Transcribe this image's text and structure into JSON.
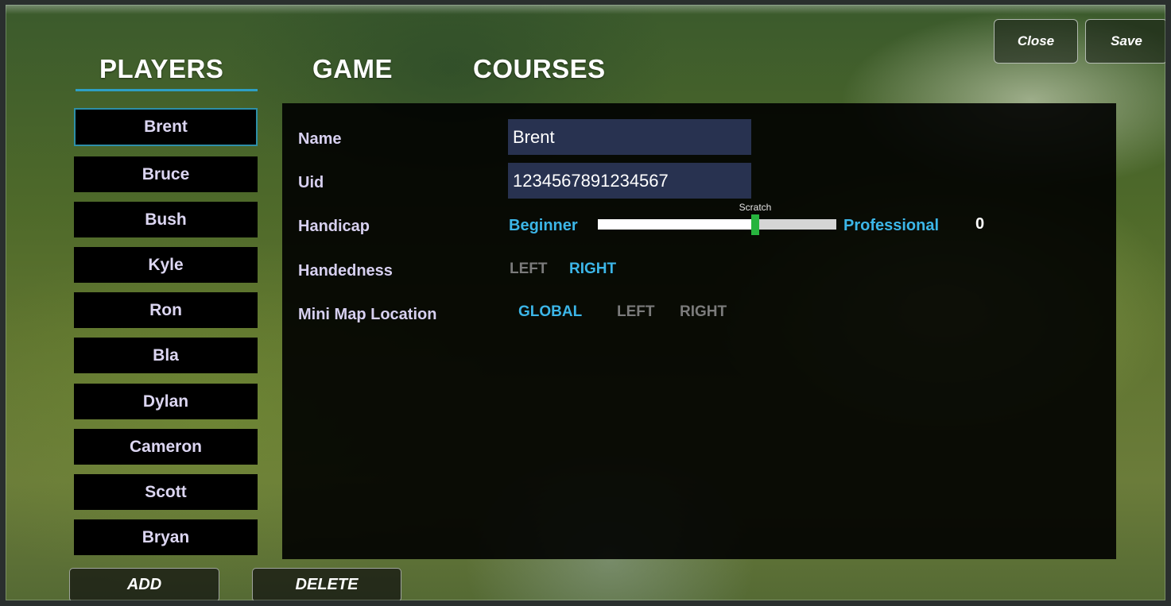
{
  "tabs": {
    "players": "PLAYERS",
    "game": "GAME",
    "courses": "COURSES"
  },
  "toolbar": {
    "close_label": "Close",
    "save_label": "Save"
  },
  "players": [
    "Brent",
    "Bruce",
    "Bush",
    "Kyle",
    "Ron",
    "Bla",
    "Dylan",
    "Cameron",
    "Scott",
    "Bryan"
  ],
  "selected_player": "Brent",
  "actions": {
    "add_label": "ADD",
    "delete_label": "DELETE"
  },
  "details": {
    "name": {
      "label": "Name",
      "value": "Brent"
    },
    "uid": {
      "label": "Uid",
      "value": "1234567891234567"
    },
    "handicap": {
      "label": "Handicap",
      "min_label": "Beginner",
      "max_label": "Professional",
      "marker_label": "Scratch",
      "slider_level_fraction": 0.66,
      "value": "0"
    },
    "handedness": {
      "label": "Handedness",
      "options": [
        "LEFT",
        "RIGHT"
      ],
      "selected": "RIGHT"
    },
    "minimap": {
      "label": "Mini Map Location",
      "options": [
        "GLOBAL",
        "LEFT",
        "RIGHT"
      ],
      "selected": "GLOBAL"
    }
  },
  "colors": {
    "accent": "#3cb6e8",
    "selection_border": "#2e8fa8",
    "slider_handle": "#27b43e",
    "input_bg": "#283250"
  }
}
